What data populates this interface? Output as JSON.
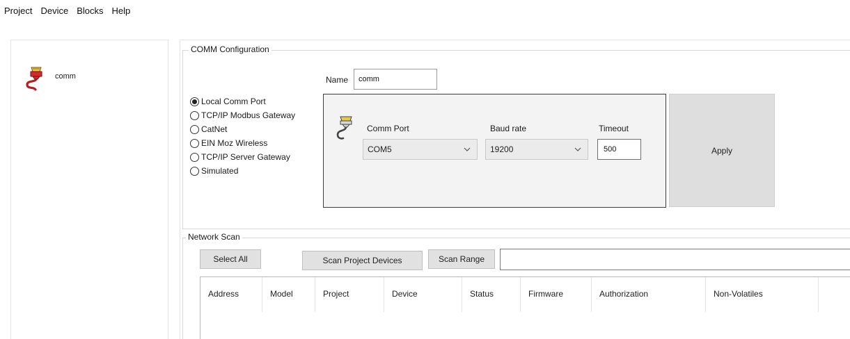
{
  "menu": [
    "Project",
    "Device",
    "Blocks",
    "Help"
  ],
  "tree": {
    "items": [
      {
        "label": "comm",
        "icon": "comm-port-icon"
      }
    ]
  },
  "comm_config": {
    "title": "COMM Configuration",
    "name_label": "Name",
    "name_value": "comm",
    "radio_options": [
      {
        "label": "Local Comm Port",
        "checked": true
      },
      {
        "label": "TCP/IP Modbus Gateway",
        "checked": false
      },
      {
        "label": "CatNet",
        "checked": false
      },
      {
        "label": "EIN Moz Wireless",
        "checked": false
      },
      {
        "label": "TCP/IP Server Gateway",
        "checked": false
      },
      {
        "label": "Simulated",
        "checked": false
      }
    ],
    "comm_port_label": "Comm Port",
    "comm_port_value": "COM5",
    "baud_rate_label": "Baud rate",
    "baud_rate_value": "19200",
    "timeout_label": "Timeout",
    "timeout_value": "500",
    "apply_label": "Apply"
  },
  "network_scan": {
    "title": "Network Scan",
    "select_all_label": "Select All",
    "scan_project_devices_label": "Scan Project Devices",
    "scan_range_label": "Scan Range",
    "scan_range_value": "",
    "columns": [
      "Address",
      "Model",
      "Project",
      "Device",
      "Status",
      "Firmware",
      "Authorization",
      "Non-Volatiles"
    ]
  },
  "colors": {
    "icon_red": "#d42a2a",
    "icon_yellow": "#e8c84a",
    "panel_gray": "#f3f3f3"
  }
}
